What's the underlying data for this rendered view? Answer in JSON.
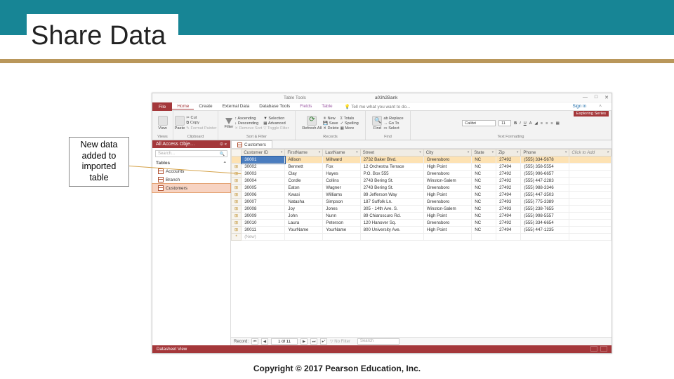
{
  "slide": {
    "title": "Share Data",
    "callout": "New data added to imported table",
    "copyright": "Copyright © 2017 Pearson Education, Inc."
  },
  "window": {
    "context_title": "Table Tools",
    "document_title": "a03h2Bank",
    "series": "Exploring Series",
    "sign_in": "Sign in",
    "tell_me": "Tell me what you want to do..."
  },
  "tabs": {
    "file": "File",
    "items": [
      "Home",
      "Create",
      "External Data",
      "Database Tools",
      "Fields",
      "Table"
    ]
  },
  "ribbon": {
    "groups": [
      "Views",
      "Clipboard",
      "Sort & Filter",
      "Records",
      "Find",
      "Text Formatting"
    ],
    "view": "View",
    "paste": "Paste",
    "cut": "Cut",
    "copy": "Copy",
    "format_painter": "Format Painter",
    "filter": "Filter",
    "ascending": "Ascending",
    "descending": "Descending",
    "remove_sort": "Remove Sort",
    "selection": "Selection",
    "advanced": "Advanced",
    "toggle_filter": "Toggle Filter",
    "refresh": "Refresh All",
    "new": "New",
    "save": "Save",
    "delete": "Delete",
    "totals": "Totals",
    "spelling": "Spelling",
    "more": "More",
    "find": "Find",
    "replace": "Replace",
    "goto": "Go To",
    "select": "Select",
    "font": "Calibri",
    "size": "11"
  },
  "nav": {
    "header": "All Access Obje…",
    "search": "Search...",
    "group": "Tables",
    "items": [
      "Accounts",
      "Branch",
      "Customers"
    ]
  },
  "object_tab": "Customers",
  "columns": [
    "Customer ID",
    "FirstName",
    "LastName",
    "Street",
    "City",
    "State",
    "Zip",
    "Phone"
  ],
  "click_to_add": "Click to Add",
  "rows": [
    {
      "id": "30001",
      "first": "Allison",
      "last": "Millward",
      "street": "2732 Baker Blvd.",
      "city": "Greensboro",
      "state": "NC",
      "zip": "27492",
      "phone": "(555) 334-5678"
    },
    {
      "id": "30002",
      "first": "Bennett",
      "last": "Fox",
      "street": "12 Orchestra Terrace",
      "city": "High Point",
      "state": "NC",
      "zip": "27494",
      "phone": "(555) 358-5554"
    },
    {
      "id": "30003",
      "first": "Clay",
      "last": "Hayes",
      "street": "P.O. Box 555",
      "city": "Greensboro",
      "state": "NC",
      "zip": "27492",
      "phone": "(555) 996-6657"
    },
    {
      "id": "30004",
      "first": "Cordle",
      "last": "Collins",
      "street": "2743 Bering St.",
      "city": "Winston-Salem",
      "state": "NC",
      "zip": "27492",
      "phone": "(555) 447-2283"
    },
    {
      "id": "30005",
      "first": "Eaton",
      "last": "Wagner",
      "street": "2743 Bering St.",
      "city": "Greensboro",
      "state": "NC",
      "zip": "27492",
      "phone": "(555) 988-3346"
    },
    {
      "id": "30006",
      "first": "Kwasi",
      "last": "Williams",
      "street": "89 Jefferson Way",
      "city": "High Point",
      "state": "NC",
      "zip": "27494",
      "phone": "(555) 447-3503"
    },
    {
      "id": "30007",
      "first": "Natasha",
      "last": "Simpson",
      "street": "187 Suffolk Ln.",
      "city": "Greensboro",
      "state": "NC",
      "zip": "27493",
      "phone": "(555) 775-3389"
    },
    {
      "id": "30008",
      "first": "Joy",
      "last": "Jones",
      "street": "305 - 14th Ave. S.",
      "city": "Winston-Salem",
      "state": "NC",
      "zip": "27493",
      "phone": "(555) 238-7655"
    },
    {
      "id": "30009",
      "first": "John",
      "last": "Nunn",
      "street": "89 Chiaroscuro Rd.",
      "city": "High Point",
      "state": "NC",
      "zip": "27494",
      "phone": "(555) 998-5557"
    },
    {
      "id": "30010",
      "first": "Laura",
      "last": "Peterson",
      "street": "120 Hanover Sq.",
      "city": "Greensboro",
      "state": "NC",
      "zip": "27492",
      "phone": "(555) 334-6654"
    },
    {
      "id": "30011",
      "first": "YourName",
      "last": "YourName",
      "street": "800 University Ave.",
      "city": "High Point",
      "state": "NC",
      "zip": "27494",
      "phone": "(555) 447-1235"
    }
  ],
  "record_nav": {
    "label": "Record:",
    "pos": "1 of 11",
    "no_filter": "No Filter",
    "search": "Search"
  },
  "status": {
    "view": "Datasheet View"
  }
}
